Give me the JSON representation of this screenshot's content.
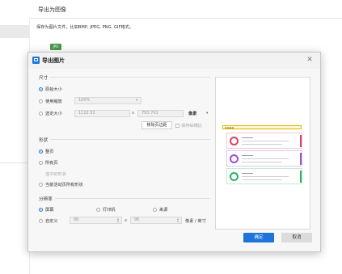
{
  "background": {
    "title": "导出为图像",
    "description": "保存为图片文件，比如BMP, JPEG, PNG, GIF格式。",
    "icon_badge": "JPG"
  },
  "dialog": {
    "title": "导出图片",
    "size_section": {
      "label": "尺寸",
      "original": "原始大小",
      "scale": "使用缩放",
      "scale_value": "100%",
      "custom": "选定大小",
      "width": "1122.52",
      "x_mark": "x",
      "height": "793.701",
      "unit": "像素",
      "remove_margin": "移除页边距",
      "keep_ratio": "保持纵横比"
    },
    "shape_section": {
      "label": "形状",
      "current_page": "整页",
      "all_pages": "所有页",
      "selected": "选中的形状",
      "current_all": "当前活动页所有形状"
    },
    "resolution_section": {
      "label": "分辨率",
      "screen": "屏幕",
      "printer": "打印机",
      "source": "来源",
      "custom": "自定义",
      "x_value": "96",
      "x_mark": "x",
      "y_value": "96",
      "unit": "像素 / 英寸"
    },
    "ok": "确定",
    "cancel": "取消"
  },
  "colors": {
    "accent": "#1e74d8",
    "card1": "#e04060",
    "card2": "#9a4fd0",
    "card3": "#2fae6a",
    "header": "#e0b400"
  }
}
